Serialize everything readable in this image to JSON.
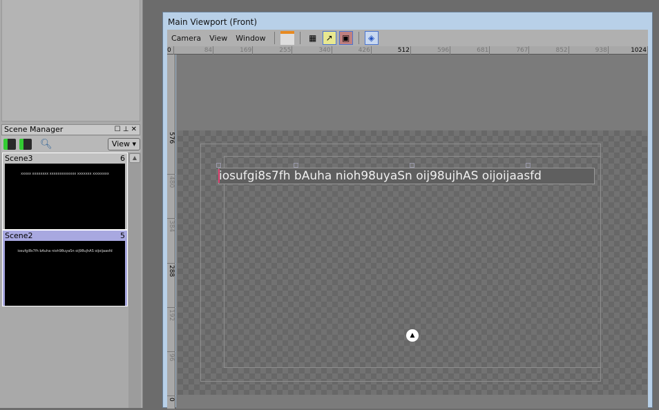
{
  "scene_manager": {
    "title": "Scene Manager",
    "view_label": "View",
    "scenes": [
      {
        "name": "Scene3",
        "count": "6",
        "preview": "xxxxx xxxxxxxx xxxxxxxxxxxxx  xxxxxxx xxxxxxxx"
      },
      {
        "name": "Scene2",
        "count": "5",
        "preview": "iosufgi8s7fh bAuha nioh98uyaSn oij98ujhAS oijoijaasfd"
      }
    ]
  },
  "viewport": {
    "title": "Main Viewport (Front)",
    "menus": [
      "Camera",
      "View",
      "Window"
    ],
    "hruler": [
      "0",
      "84",
      "169",
      "255",
      "340",
      "426",
      "512",
      "596",
      "681",
      "767",
      "852",
      "938",
      "1024"
    ],
    "vruler": [
      "576",
      "480",
      "384",
      "288",
      "192",
      "96",
      "0"
    ],
    "text": "iosufgi8s7fh bAuha nioh98uyaSn oij98ujhAS oijoijaasfd"
  },
  "colors": {
    "selected_scene": "#a8a8e0",
    "active_tool": "#4a74d0"
  }
}
